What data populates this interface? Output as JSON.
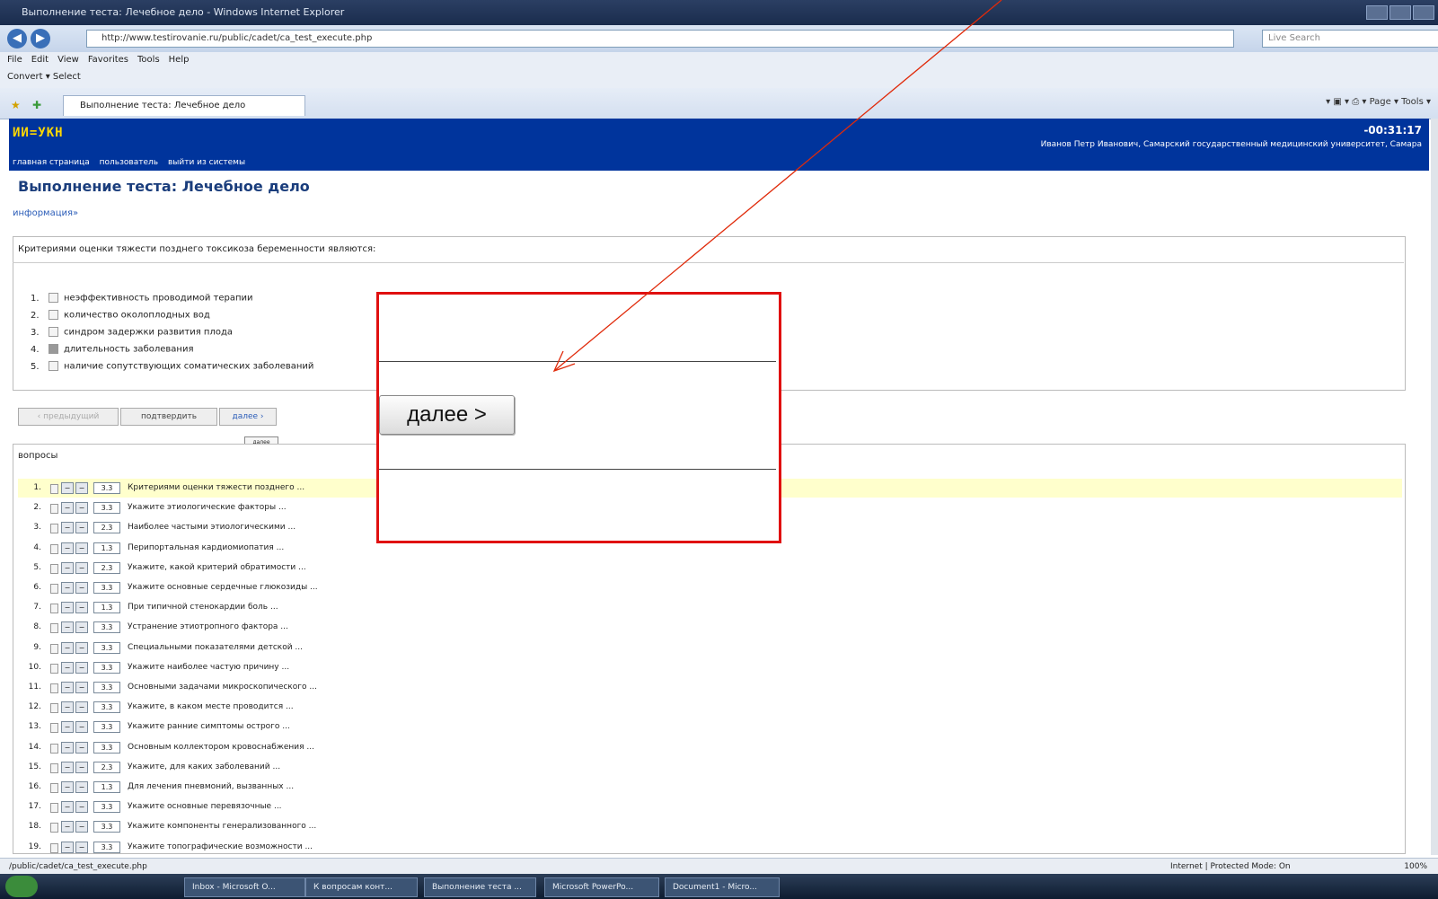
{
  "browser": {
    "window_title": "Выполнение теста: Лечебное дело - Windows Internet Explorer",
    "url": "http://www.testirovanie.ru/public/cadet/ca_test_execute.php",
    "search_placeholder": "Live Search",
    "menu": [
      "File",
      "Edit",
      "View",
      "Favorites",
      "Tools",
      "Help"
    ],
    "links_bar": "Convert  ▾  Select",
    "tab_title": "Выполнение теста: Лечебное дело",
    "tools_text": "▾ ▣ ▾ ⎙ ▾ Page ▾ Tools ▾"
  },
  "site": {
    "logo": "ИИ=УКН",
    "timer": "-00:31:17",
    "user_line": "Иванов Петр Иванович, Самарский государственный медицинский университет, Самара",
    "nav": [
      "главная страница",
      "пользователь",
      "выйти из системы"
    ]
  },
  "page": {
    "title": "Выполнение теста: Лечебное дело",
    "info_link": "информация»",
    "question": "Критериями оценки тяжести позднего токсикоза беременности являются:",
    "options": [
      {
        "num": "1.",
        "text": "неэффективность проводимой терапии",
        "checked": false
      },
      {
        "num": "2.",
        "text": "количество околоплодных вод",
        "checked": false
      },
      {
        "num": "3.",
        "text": "синдром задержки развития плода",
        "checked": false
      },
      {
        "num": "4.",
        "text": "длительность заболевания",
        "checked": true
      },
      {
        "num": "5.",
        "text": "наличие сопутствующих соматических заболеваний",
        "checked": false
      }
    ],
    "buttons": {
      "prev": "‹ предыдущий",
      "confirm": "подтвердить",
      "next": "далее ›"
    },
    "tooltip_small": "далее",
    "questions_label": "вопросы",
    "questions": [
      {
        "num": "1.",
        "score": "3.3",
        "text": "Критериями оценки тяжести позднего ..."
      },
      {
        "num": "2.",
        "score": "3.3",
        "text": "Укажите этиологические факторы ..."
      },
      {
        "num": "3.",
        "score": "2.3",
        "text": "Наиболее частыми этиологическими ..."
      },
      {
        "num": "4.",
        "score": "1.3",
        "text": "Перипортальная кардиомиопатия ..."
      },
      {
        "num": "5.",
        "score": "2.3",
        "text": "Укажите, какой критерий обратимости ..."
      },
      {
        "num": "6.",
        "score": "3.3",
        "text": "Укажите основные сердечные глюкозиды ..."
      },
      {
        "num": "7.",
        "score": "1.3",
        "text": "При типичной стенокардии боль ..."
      },
      {
        "num": "8.",
        "score": "3.3",
        "text": "Устранение этиотропного фактора ..."
      },
      {
        "num": "9.",
        "score": "3.3",
        "text": "Специальными показателями детской ..."
      },
      {
        "num": "10.",
        "score": "3.3",
        "text": "Укажите наиболее частую причину ..."
      },
      {
        "num": "11.",
        "score": "3.3",
        "text": "Основными задачами микроскопического ..."
      },
      {
        "num": "12.",
        "score": "3.3",
        "text": "Укажите, в каком месте проводится ..."
      },
      {
        "num": "13.",
        "score": "3.3",
        "text": "Укажите ранние симптомы острого ..."
      },
      {
        "num": "14.",
        "score": "3.3",
        "text": "Основным коллектором кровоснабжения ..."
      },
      {
        "num": "15.",
        "score": "2.3",
        "text": "Укажите, для каких заболеваний ..."
      },
      {
        "num": "16.",
        "score": "1.3",
        "text": "Для лечения пневмоний, вызванных ..."
      },
      {
        "num": "17.",
        "score": "3.3",
        "text": "Укажите основные перевязочные ..."
      },
      {
        "num": "18.",
        "score": "3.3",
        "text": "Укажите компоненты генерализованного ..."
      },
      {
        "num": "19.",
        "score": "3.3",
        "text": "Укажите топографические возможности ..."
      }
    ]
  },
  "status": {
    "left": "/public/cadet/ca_test_execute.php",
    "zone": "Internet | Protected Mode: On",
    "zoom": "100%"
  },
  "taskbar": {
    "tasks": [
      "Inbox - Microsoft O...",
      "К вопросам конт...",
      "Выполнение теста ...",
      "Microsoft PowerPo...",
      "Document1 - Micro..."
    ]
  },
  "callout": {
    "button_label": "далее >"
  }
}
